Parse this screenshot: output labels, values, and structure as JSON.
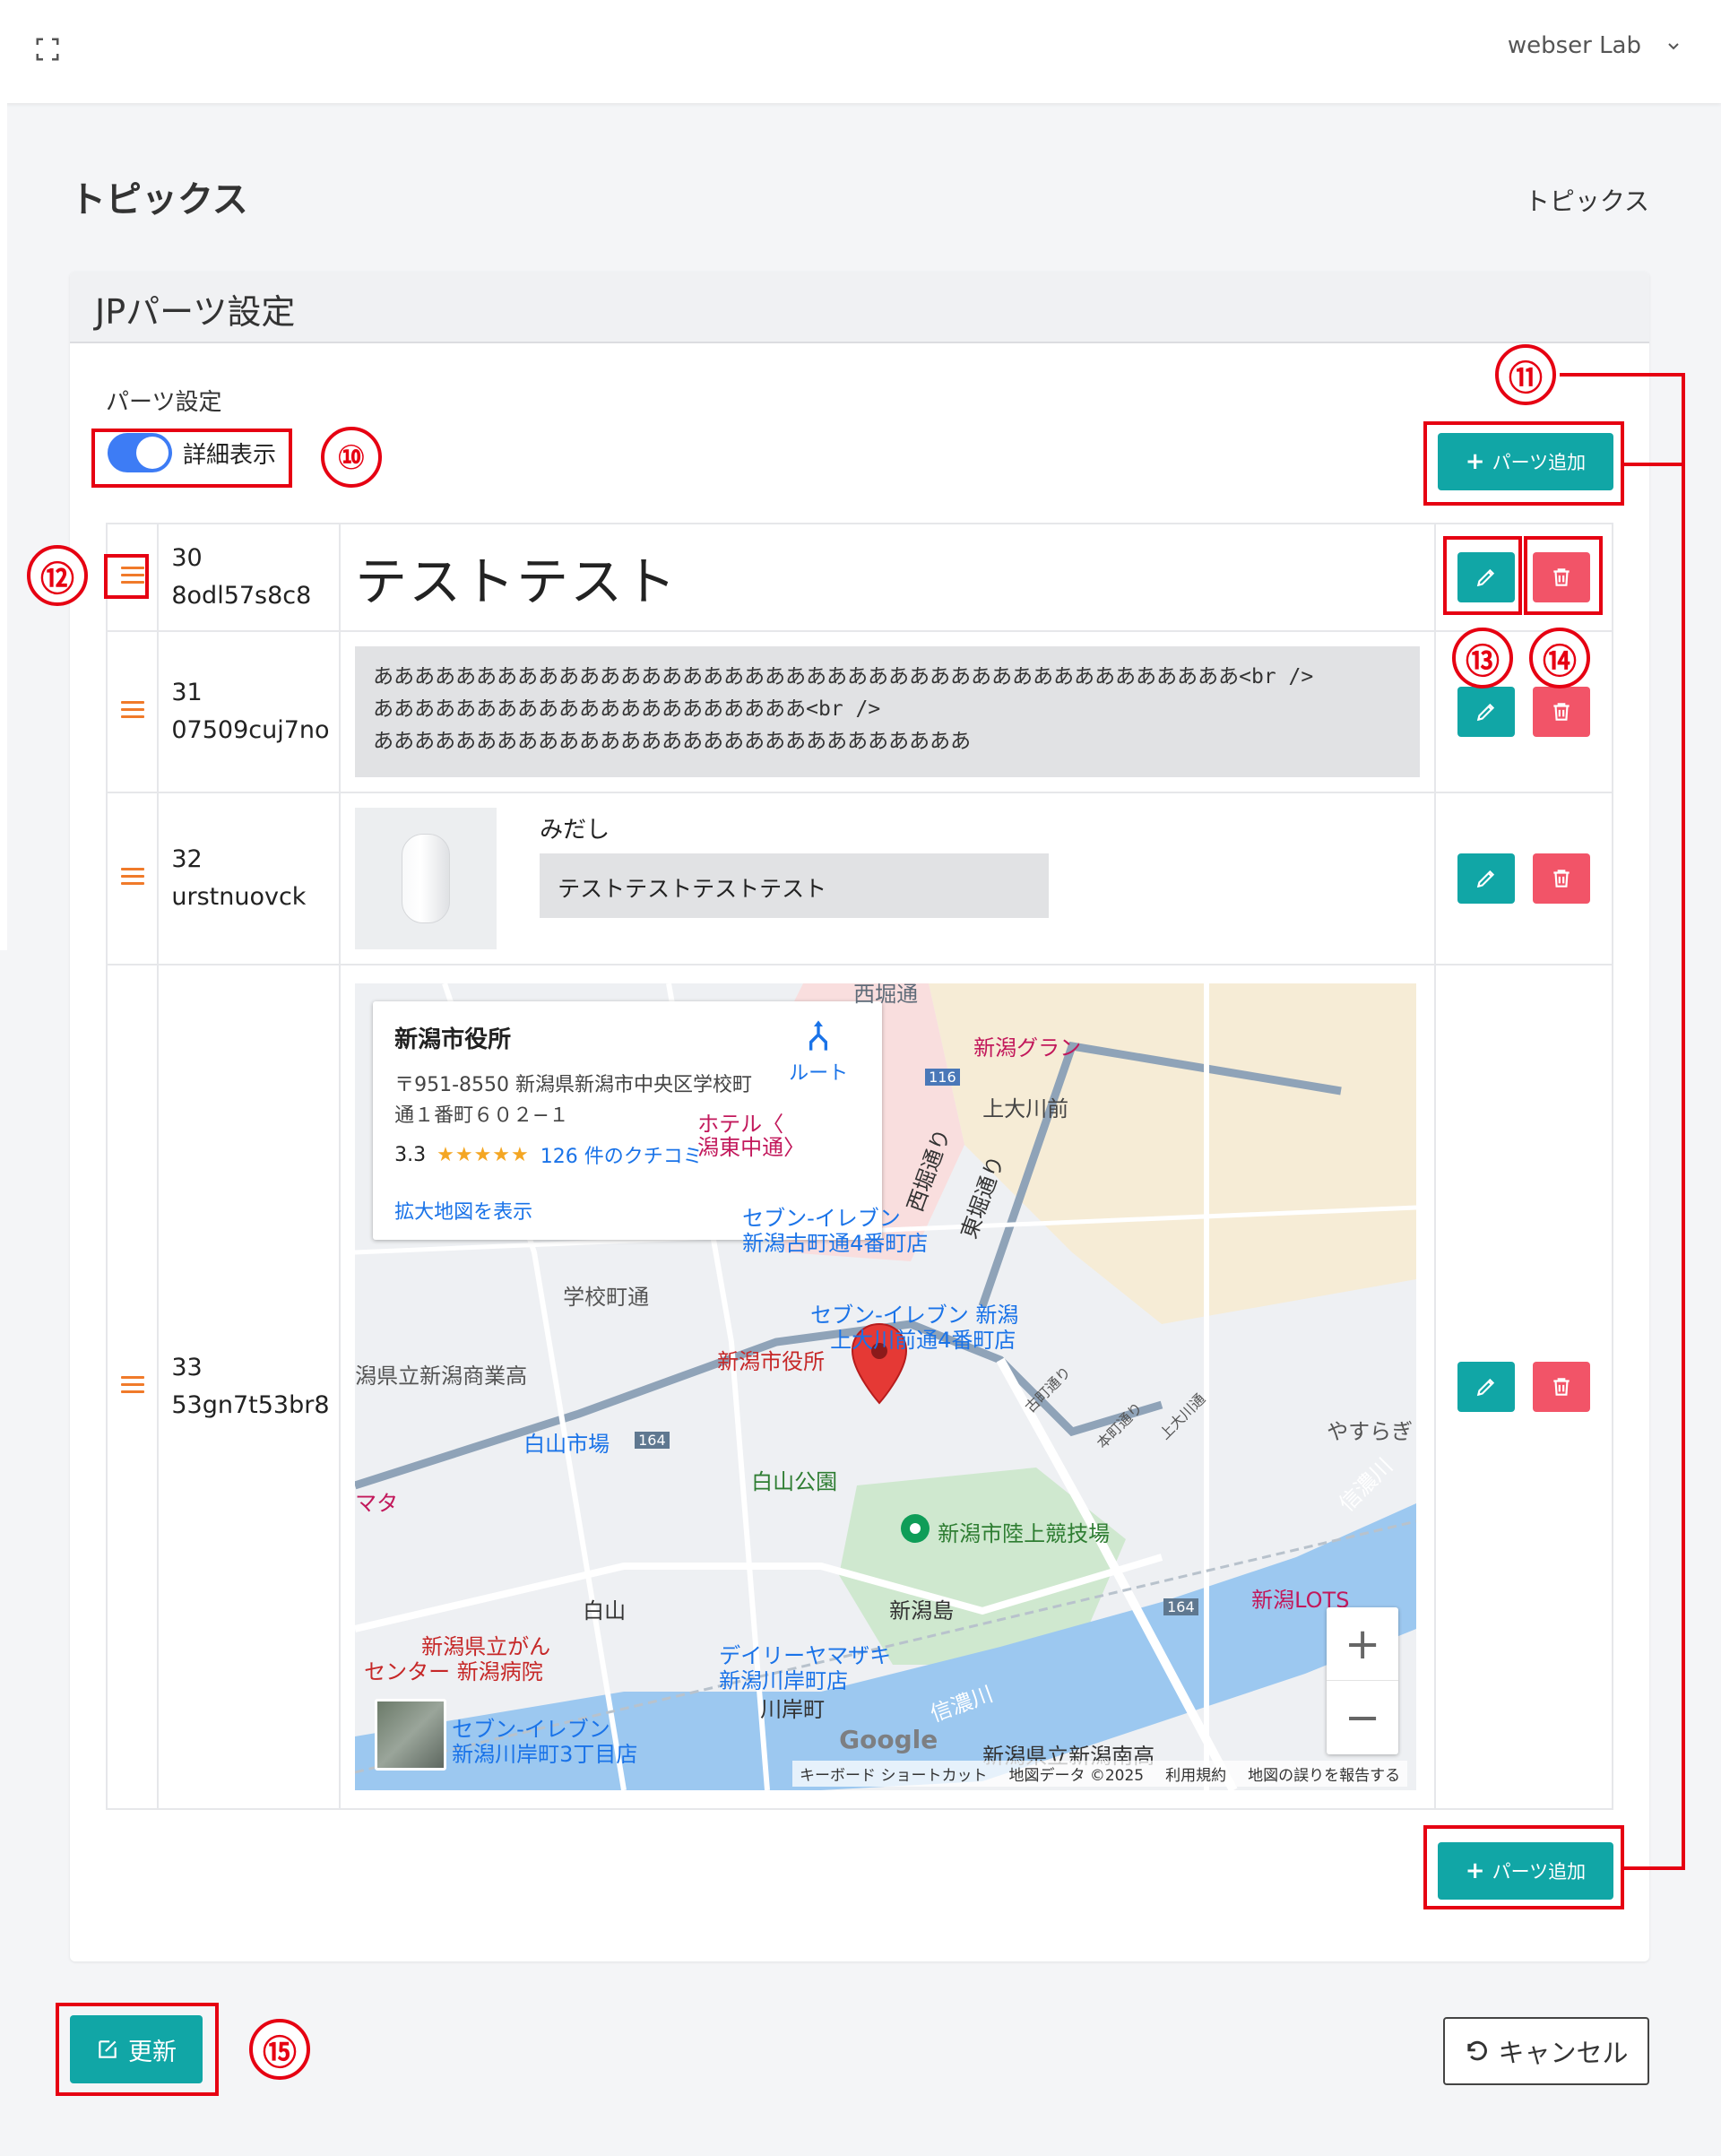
{
  "header": {
    "user": "webser Lab"
  },
  "page": {
    "title": "トピックス",
    "breadcrumb": "トピックス"
  },
  "card": {
    "title": "JPパーツ設定",
    "parts_label": "パーツ設定",
    "toggle_label": "詳細表示",
    "add_button": "パーツ追加"
  },
  "rows": [
    {
      "num": "30",
      "code": "8odl57s8c8",
      "text": "テストテスト"
    },
    {
      "num": "31",
      "code": "07509cuj7no",
      "text": "ああああああああああああああああああああああああああああああああああああああああああ<br />\nあああああああああああああああああああああ<br />\nあああああああああああああああああああああああああああああ"
    },
    {
      "num": "32",
      "code": "urstnuovck",
      "heading_label": "みだし",
      "heading_value": "テストテストテストテスト"
    },
    {
      "num": "33",
      "code": "53gn7t53br8"
    }
  ],
  "map": {
    "place_name": "新潟市役所",
    "address": "〒951-8550 新潟県新潟市中央区学校町通１番町６０２−１",
    "rating": "3.3",
    "stars": "★★★★★",
    "reviews": "126 件のクチコミ",
    "route": "ルート",
    "larger_map": "拡大地図を表示",
    "zoom_in": "+",
    "zoom_out": "−",
    "google": "Google",
    "footer": [
      "キーボード ショートカット",
      "地図データ ©2025",
      "利用規約",
      "地図の誤りを報告する"
    ],
    "labels": [
      "西堀通",
      "新潟グラン",
      "上大川前",
      "116",
      "ホテル〈",
      "潟東中通〉",
      "西堀通り",
      "東堀通り",
      "セブン-イレブン",
      "新潟古町通4番町店",
      "学校町通",
      "新潟市役所",
      "セブン-イレブン 新潟",
      "上大川前通4番町店",
      "潟県立新潟商業高",
      "白山市場",
      "164",
      "白山公園",
      "新潟市陸上競技場",
      "マタ",
      "新潟島",
      "白山",
      "新潟県立がん",
      "センター 新潟病院",
      "デイリーヤマザキ",
      "新潟川岸町店",
      "川岸町",
      "セブン-イレブン",
      "新潟川岸町3丁目店",
      "信濃川",
      "新潟県立新潟南高",
      "新潟LOTS",
      "やすらぎ",
      "信濃川",
      "164",
      "古町通り",
      "本町通り",
      "上大川通"
    ]
  },
  "actions": {
    "update": "更新",
    "cancel": "キャンセル"
  },
  "annotations": [
    "⑩",
    "⑪",
    "⑫",
    "⑬",
    "⑭",
    "⑮"
  ],
  "colors": {
    "teal": "#11a6a6",
    "danger": "#f25468",
    "toggle": "#3d7cf5",
    "annotation": "#e60012",
    "drag": "#f07a2a"
  }
}
